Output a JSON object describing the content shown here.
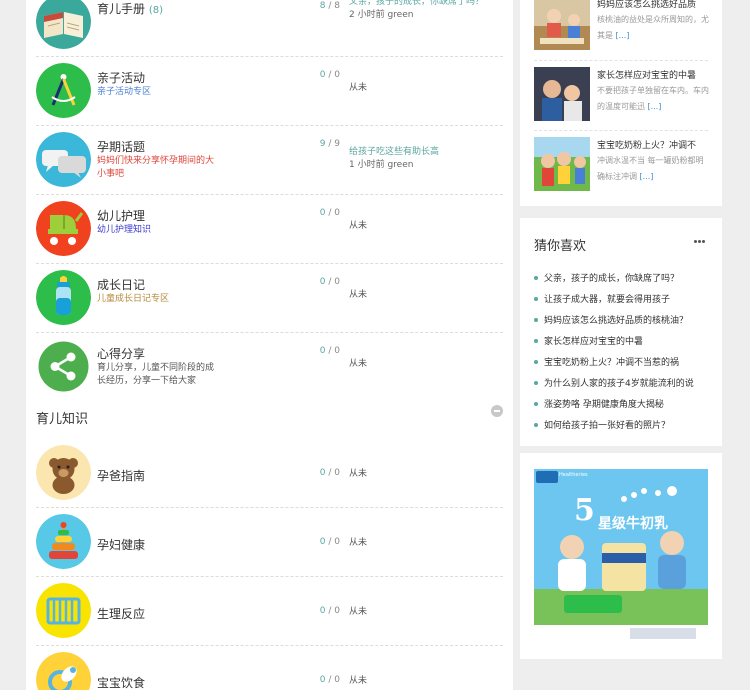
{
  "forums_top": [
    {
      "title": "育儿手册",
      "count": "(8)",
      "desc": "",
      "stats_new": "8",
      "stats_total": "8",
      "last_link": "父亲，孩子的成长，你缺席了吗？",
      "last_meta": "2 小时前 green",
      "never": ""
    },
    {
      "title": "亲子活动",
      "count": "",
      "desc": "亲子活动专区",
      "desc_color": "#4a7fd6",
      "stats_new": "0",
      "stats_total": "0",
      "last_link": "",
      "last_meta": "",
      "never": "从未"
    },
    {
      "title": "孕期话题",
      "count": "",
      "desc": "妈妈们快来分享怀孕期间的大小事吧",
      "desc_color": "#e0453a",
      "stats_new": "9",
      "stats_total": "9",
      "last_link": "给孩子吃这些有助长高",
      "last_meta": "1 小时前 green",
      "never": ""
    },
    {
      "title": "幼儿护理",
      "count": "",
      "desc": "幼儿护理知识",
      "desc_color": "#3a3acf",
      "stats_new": "0",
      "stats_total": "0",
      "last_link": "",
      "last_meta": "",
      "never": "从未"
    },
    {
      "title": "成长日记",
      "count": "",
      "desc": "儿童成长日记专区",
      "desc_color": "#b7893a",
      "stats_new": "0",
      "stats_total": "0",
      "last_link": "",
      "last_meta": "",
      "never": "从未"
    },
    {
      "title": "心得分享",
      "count": "",
      "desc": "育儿分享，儿童不同阶段的成长经历，分享一下给大家",
      "desc_color": "#555555",
      "stats_new": "0",
      "stats_total": "0",
      "last_link": "",
      "last_meta": "",
      "never": "从未"
    }
  ],
  "section": {
    "title": "育儿知识"
  },
  "forums_bottom": [
    {
      "title": "孕爸指南",
      "stats_new": "0",
      "stats_total": "0",
      "never": "从未"
    },
    {
      "title": "孕妇健康",
      "stats_new": "0",
      "stats_total": "0",
      "never": "从未"
    },
    {
      "title": "生理反应",
      "stats_new": "0",
      "stats_total": "0",
      "never": "从未"
    },
    {
      "title": "宝宝饮食",
      "stats_new": "0",
      "stats_total": "0",
      "never": "从未"
    }
  ],
  "sep": "/",
  "news": [
    {
      "title": "妈妈应该怎么挑选好品质",
      "summary": "核桃油的益处是众所周知的，尤其是",
      "more": "[...]"
    },
    {
      "title": "家长怎样应对宝宝的中暑",
      "summary": "不要把孩子单独留在车内。车内的温度可能迅",
      "more": "[...]"
    },
    {
      "title": "宝宝吃奶粉上火？冲调不",
      "summary": "冲调水温不当 每一罐奶粉都明确标注冲调",
      "more": "[...]"
    }
  ],
  "guess": {
    "title": "猜你喜欢",
    "items": [
      "父亲，孩子的成长，你缺席了吗？",
      "让孩子成大器，就要会得用孩子",
      "妈妈应该怎么挑选好品质的核桃油？",
      "家长怎样应对宝宝的中暑",
      "宝宝吃奶粉上火？冲调不当惹的祸",
      "为什么别人家的孩子4岁就能流利的说",
      "涨姿势咯 孕期健康角度大揭秘",
      "如何给孩子拍一张好看的照片？"
    ]
  },
  "ad": {
    "big": "5",
    "text": "星级牛初乳",
    "brand": "Healtheries"
  },
  "colors": {
    "accent": "#5aa7a0",
    "link_blue": "#3a8fc9"
  }
}
